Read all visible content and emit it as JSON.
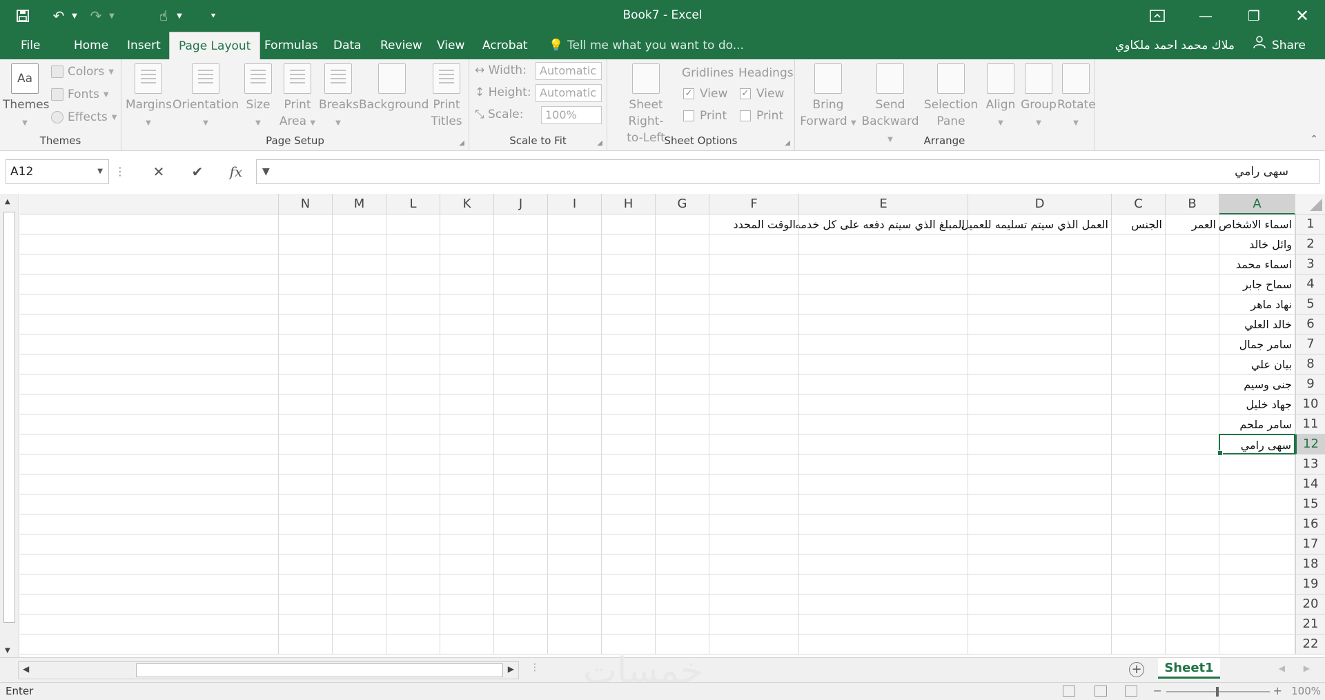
{
  "window": {
    "title": "Book7 - Excel",
    "colors": {
      "brand": "#217346",
      "ribbon_bg": "#f3f3f3"
    }
  },
  "quick_access": [
    {
      "name": "save-icon",
      "glyph": "🖫"
    },
    {
      "name": "undo-icon",
      "glyph": "↶"
    },
    {
      "name": "redo-icon",
      "glyph": "↷"
    },
    {
      "name": "touch-mode-icon",
      "glyph": "☝"
    },
    {
      "name": "customize-qat-icon",
      "glyph": "▾"
    }
  ],
  "ribbon_tabs": [
    "File",
    "Home",
    "Insert",
    "Page Layout",
    "Formulas",
    "Data",
    "Review",
    "View",
    "Acrobat"
  ],
  "active_tab": "Page Layout",
  "tell_me": "Tell me what you want to do...",
  "user_name": "ملاك محمد احمد ملكاوي",
  "share_label": "Share",
  "ribbon": {
    "themes": {
      "themes": "Themes",
      "colors": "Colors",
      "fonts": "Fonts",
      "effects": "Effects",
      "group": "Themes"
    },
    "page_setup": {
      "margins": "Margins",
      "orientation": "Orientation",
      "size": "Size",
      "print_area_1": "Print",
      "print_area_2": "Area",
      "breaks": "Breaks",
      "background": "Background",
      "print_titles_1": "Print",
      "print_titles_2": "Titles",
      "group": "Page Setup"
    },
    "scale_to_fit": {
      "width_label": "Width:",
      "width_value": "Automatic",
      "height_label": "Height:",
      "height_value": "Automatic",
      "scale_label": "Scale:",
      "scale_value": "100%",
      "group": "Scale to Fit"
    },
    "sheet_options": {
      "sheet_rtl_1": "Sheet Right-",
      "sheet_rtl_2": "to-Left",
      "gridlines": "Gridlines",
      "headings": "Headings",
      "view": "View",
      "print": "Print",
      "group": "Sheet Options"
    },
    "arrange": {
      "bring_1": "Bring",
      "bring_2": "Forward",
      "send_1": "Send",
      "send_2": "Backward",
      "selection_1": "Selection",
      "selection_2": "Pane",
      "align": "Align",
      "group_btn": "Group",
      "rotate": "Rotate",
      "group": "Arrange"
    }
  },
  "formula_bar": {
    "name_box": "A12",
    "fx": "fx",
    "content": "سهى رامي"
  },
  "columns": [
    "A",
    "B",
    "C",
    "D",
    "E",
    "F",
    "G",
    "H",
    "I",
    "J",
    "K",
    "L",
    "M",
    "N"
  ],
  "rows": [
    "1",
    "2",
    "3",
    "4",
    "5",
    "6",
    "7",
    "8",
    "9",
    "10",
    "11",
    "12",
    "13",
    "14",
    "15",
    "16",
    "17",
    "18",
    "19",
    "20",
    "21",
    "22"
  ],
  "selected_cell": {
    "column": "A",
    "row": "12"
  },
  "cells": {
    "A1": "اسماء الاشخاص",
    "B1": "العمر",
    "C1": "الجنس",
    "D1": "العمل الذي سيتم تسليمه للعميل",
    "E1": "المبلغ الذي سيتم دفعه على كل خدمه",
    "F1": "الوقت المحدد",
    "A2": "وائل خالد",
    "A3": "اسماء محمد",
    "A4": "سماح جابر",
    "A5": "نهاد ماهر",
    "A6": "خالد العلي",
    "A7": "سامر جمال",
    "A8": "بيان علي",
    "A9": "جنى وسيم",
    "A10": "جهاد خليل",
    "A11": "سامر ملحم",
    "A12": "سهى رامي"
  },
  "sheet_tab": "Sheet1",
  "status": {
    "mode": "Enter",
    "zoom": "100%"
  },
  "watermark": "خمسات"
}
